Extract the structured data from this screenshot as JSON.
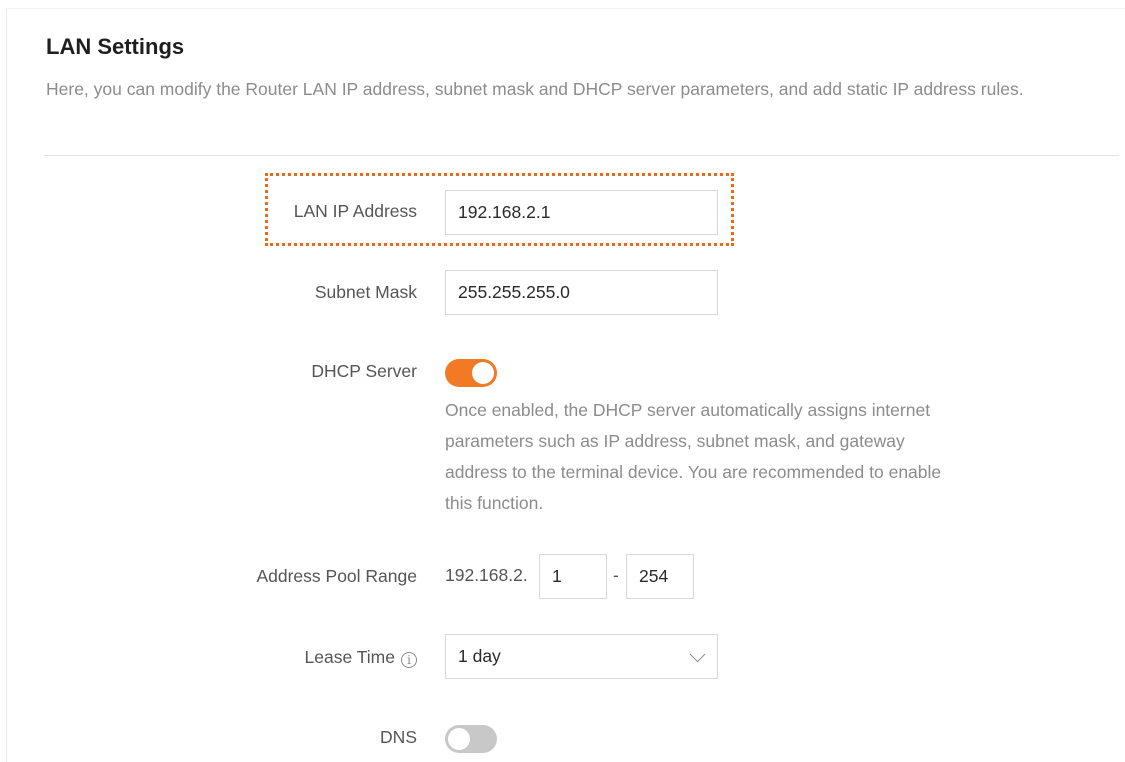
{
  "header": {
    "title": "LAN Settings",
    "description": "Here, you can modify the Router LAN IP address, subnet mask and DHCP server parameters, and add static IP address rules."
  },
  "form": {
    "lan_ip": {
      "label": "LAN IP Address",
      "value": "192.168.2.1"
    },
    "subnet_mask": {
      "label": "Subnet Mask",
      "value": "255.255.255.0"
    },
    "dhcp_server": {
      "label": "DHCP Server",
      "enabled": true,
      "hint": "Once enabled, the DHCP server automatically assigns internet parameters such as IP address, subnet mask, and gateway address to the terminal device. You are recommended to enable this function."
    },
    "address_pool": {
      "label": "Address Pool Range",
      "prefix": "192.168.2.",
      "start": "1",
      "separator": "-",
      "end": "254"
    },
    "lease_time": {
      "label": "Lease Time",
      "info_icon": "info-circle-icon",
      "value": "1 day"
    },
    "dns": {
      "label": "DNS",
      "enabled": false
    }
  },
  "colors": {
    "accent": "#ee6a12",
    "toggle_on": "#f27a24",
    "toggle_off": "#c8c8c8",
    "highlight_border": "#ee6a12"
  }
}
